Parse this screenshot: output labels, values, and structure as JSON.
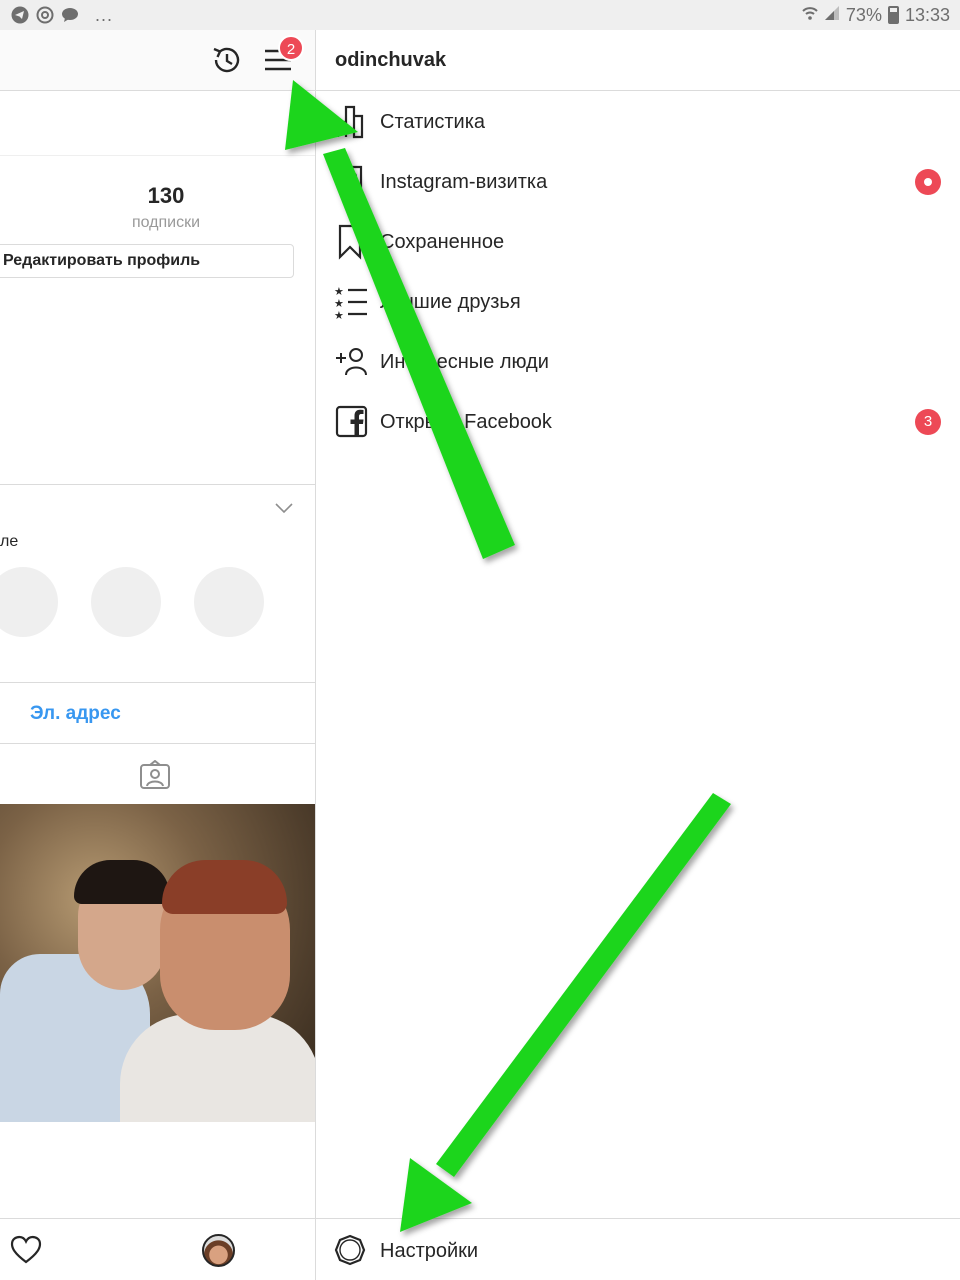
{
  "status_bar": {
    "icons": [
      "telegram-icon",
      "at-icon",
      "message-icon"
    ],
    "more": "...",
    "battery": "73%",
    "battery_level": 0.73,
    "time": "13:33"
  },
  "header": {
    "menu_badge": "2"
  },
  "profile": {
    "following_count": "130",
    "following_label": "подписки",
    "edit_profile_label": "Редактировать профиль",
    "highlights_label": "ле",
    "email_label": "Эл. адрес"
  },
  "drawer": {
    "username": "odinchuvak",
    "items": [
      {
        "label": "Статистика",
        "icon": "insights-icon"
      },
      {
        "label": "Instagram-визитка",
        "icon": "nametag-icon",
        "indicator": "dot"
      },
      {
        "label": "Сохраненное",
        "icon": "bookmark-icon"
      },
      {
        "label": "Лучшие друзья",
        "icon": "close-friends-icon"
      },
      {
        "label": "Интересные люди",
        "icon": "discover-people-icon"
      },
      {
        "label": "Открыть Facebook",
        "icon": "facebook-icon",
        "badge": "3"
      }
    ],
    "settings_label": "Настройки"
  },
  "colors": {
    "badge": "#ed4956",
    "link": "#3897f0",
    "annotation_arrow": "#1fd51f"
  }
}
